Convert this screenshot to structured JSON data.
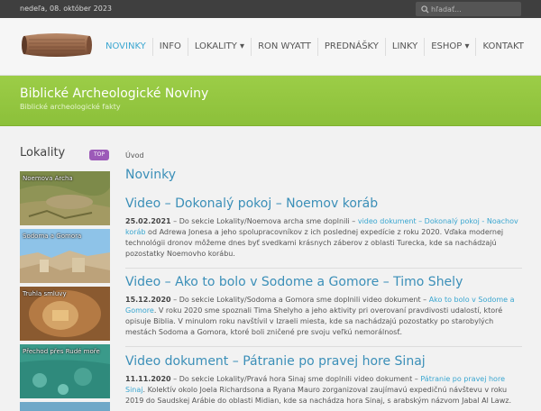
{
  "topbar": {
    "date": "nedeľa, 08. október 2023",
    "search_placeholder": "hľadať..."
  },
  "nav": [
    "NOVINKY",
    "INFO",
    "LOKALITY ▾",
    "RON WYATT",
    "PREDNÁŠKY",
    "LINKY",
    "ESHOP ▾",
    "KONTAKT"
  ],
  "banner": {
    "title": "Biblické Archeologické Noviny",
    "subtitle": "Biblické archeologické fakty"
  },
  "sidebar": {
    "title": "Lokality",
    "badge": "TOP",
    "items": [
      {
        "label": "Noemova Archa"
      },
      {
        "label": "Sodoma a Gomora"
      },
      {
        "label": "Truhla smluvy"
      },
      {
        "label": "Přechod přes Rudé moře"
      }
    ]
  },
  "main": {
    "breadcrumb": "Úvod",
    "page_title": "Novinky",
    "posts": [
      {
        "title": "Video – Dokonalý pokoj – Noemov koráb",
        "date": "25.02.2021",
        "pre": " – Do sekcie Lokality/Noemova archa sme doplnili – ",
        "link": "video dokument – Dokonalý pokoj - Noachov koráb",
        "post": " od Adrewa Jonesa a jeho spolupracovníkov z ich poslednej expedície z roku 2020. Vďaka modernej technológii dronov môžeme dnes byť svedkami krásnych záberov z oblasti Turecka, kde sa nachádzajú pozostatky Noemovho korábu."
      },
      {
        "title": "Video – Ako to bolo v Sodome a Gomore – Timo Shely",
        "date": "15.12.2020",
        "pre": " – Do sekcie Lokality/Sodoma a Gomora sme doplnili video dokument – ",
        "link": "Ako to bolo v Sodome a Gomore",
        "post": ". V roku 2020 sme spoznali Tima Shelyho a jeho aktivity pri overovaní pravdivosti udalostí, ktoré opisuje Biblia. V minulom roku navštívil v Izraeli miesta, kde sa nachádzajú pozostatky po starobylých mestách Sodoma a Gomora, ktoré boli zničené pre svoju veľkú nemorálnosť."
      },
      {
        "title": "Video dokument – Pátranie po pravej hore Sinaj",
        "date": "11.11.2020",
        "pre": " – Do sekcie Lokality/Pravá hora Sinaj sme doplnili video dokument – ",
        "link": "Pátranie po pravej hore Sinaj",
        "post": ". Kolektív okolo Joela Richardsona a Ryana Mauro zorganizoval zaujímavú expedičnú návštevu v roku 2019 do Saudskej Arábie do oblasti Midian, kde sa nachádza hora Sinaj, s arabským názvom Jabal Al Lawz."
      }
    ]
  }
}
